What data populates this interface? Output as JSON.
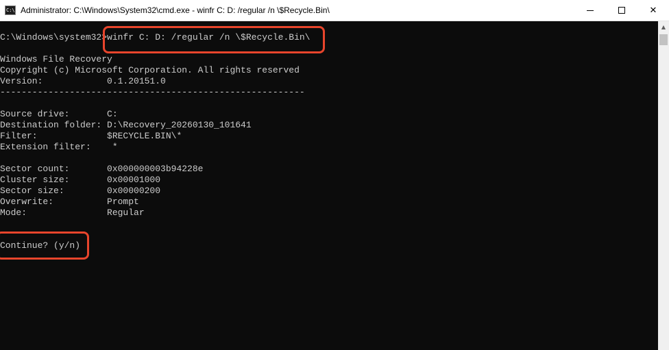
{
  "window": {
    "title": "Administrator: C:\\Windows\\System32\\cmd.exe - winfr  C: D: /regular /n \\$Recycle.Bin\\",
    "icon": "cmd-icon",
    "icon_text": "C:\\"
  },
  "controls": {
    "minimize": "minimize-icon",
    "maximize": "maximize-icon",
    "close": "✕"
  },
  "console": {
    "lines": [
      "C:\\Windows\\system32>winfr C: D: /regular /n \\$Recycle.Bin\\",
      "",
      "Windows File Recovery",
      "Copyright (c) Microsoft Corporation. All rights reserved",
      "Version:            0.1.20151.0",
      "---------------------------------------------------------",
      "",
      "Source drive:       C:",
      "Destination folder: D:\\Recovery_20260130_101641",
      "Filter:             $RECYCLE.BIN\\*",
      "Extension filter:    *",
      "",
      "Sector count:       0x000000003b94228e",
      "Cluster size:       0x00001000",
      "Sector size:        0x00000200",
      "Overwrite:          Prompt",
      "Mode:               Regular",
      "",
      "",
      "Continue? (y/n)"
    ]
  },
  "colors": {
    "console_bg": "#0c0c0c",
    "console_text": "#cccccc",
    "highlight": "#e8452c"
  }
}
